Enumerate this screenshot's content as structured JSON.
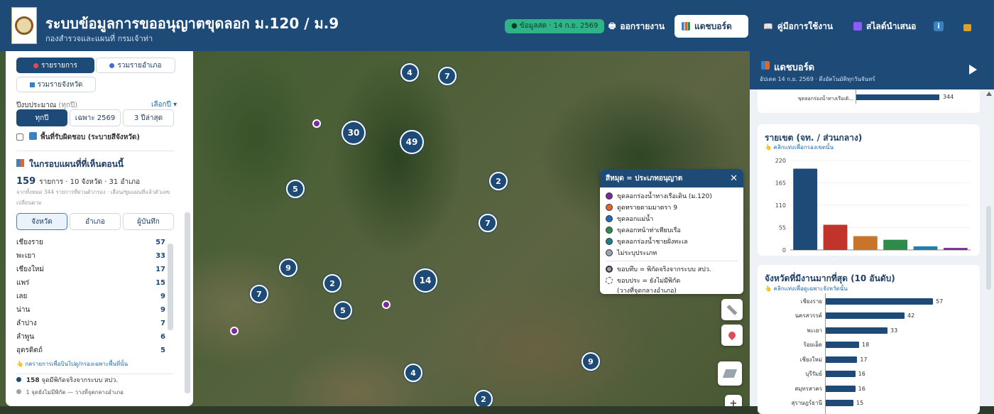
{
  "header": {
    "title": "ระบบข้อมูลการขออนุญาตขุดลอก ม.120 / ม.9",
    "subtitle": "กองสำรวจและแผนที่ กรมเจ้าท่า",
    "data_pill": "● ข้อมูลสด · 14 ก.ย. 2569",
    "nav": {
      "report": "ออกรายงาน",
      "dashboard": "แดชบอร์ด",
      "manual": "คู่มือการใช้งาน",
      "slides": "สไลด์นำเสนอ"
    }
  },
  "left": {
    "view_tabs": {
      "list": "รายรายการ",
      "district": "รวมรายอำเภอ",
      "province": "รวมรายจังหวัด"
    },
    "budget_label": "ปีงบประมาณ",
    "budget_hint": "(ทุกปี)",
    "budget_select": "เลือกปี ▾",
    "year_tabs": {
      "all": "ทุกปี",
      "only": "เฉพาะ 2569",
      "last3": "3 ปีล่าสุด"
    },
    "area_checkbox": "พื้นที่รับผิดชอบ (ระบายสีจังหวัด)",
    "inframe_title": "ในกรอบแผนที่ที่เห็นตอนนี้",
    "inframe_count": "159",
    "inframe_summary": "รายการ · 10 จังหวัด · 31 อำเภอ",
    "inframe_note": "จากทั้งหมด 344 รายการที่ผ่านตัวกรอง · เลื่อน/ซูมแผนที่แล้วตัวเลขเปลี่ยนตาม",
    "group_tabs": {
      "province": "จังหวัด",
      "district": "อำเภอ",
      "recorder": "ผู้บันทึก"
    },
    "provinces": [
      {
        "name": "เชียงราย",
        "count": "57"
      },
      {
        "name": "พะเยา",
        "count": "33"
      },
      {
        "name": "เชียงใหม่",
        "count": "17"
      },
      {
        "name": "แพร่",
        "count": "15"
      },
      {
        "name": "เลย",
        "count": "9"
      },
      {
        "name": "น่าน",
        "count": "9"
      },
      {
        "name": "ลำปาง",
        "count": "7"
      },
      {
        "name": "ลำพูน",
        "count": "6"
      },
      {
        "name": "อุตรดิตถ์",
        "count": "5"
      }
    ],
    "hint_click": "กดรายการเพื่อบินไปดู/กรองเฉพาะพื้นที่นั้น",
    "pinned_count": "158",
    "pinned_text": "จุดมีพิกัดจริงจากระบบ สปว.",
    "unpinned_text": "1 จุดยังไม่มีพิกัด — วางที่จุดกลางอำเภอ"
  },
  "map": {
    "clusters": [
      "4",
      "7",
      "30",
      "49",
      "5",
      "2",
      "7",
      "9",
      "2",
      "14",
      "7",
      "5",
      "4",
      "9",
      "2"
    ]
  },
  "legend": {
    "title": "สีหมุด = ประเภทอนุญาต",
    "items": [
      {
        "label": "ขุดลอกร่องน้ำทางเรือเดิน (ม.120)",
        "color": "#7b2a9e"
      },
      {
        "label": "ดูดทรายตามมาตรา 9",
        "color": "#e0672a"
      },
      {
        "label": "ขุดลอกแม่น้ำ",
        "color": "#1f6fb2"
      },
      {
        "label": "ขุดลอกหน้าท่าเทียบเรือ",
        "color": "#2e8b4a"
      },
      {
        "label": "ขุดลอกร่องน้ำชายฝั่งทะเล",
        "color": "#1c7f8a"
      },
      {
        "label": "ไม่ระบุประเภท",
        "color": "#9aa4b0"
      }
    ],
    "border_solid": "ขอบทึบ = พิกัดจริงจากระบบ สปว.",
    "border_dashed": "ขอบประ = ยังไม่มีพิกัด",
    "border_dashed_2": "(วางที่จุดกลางอำเภอ)"
  },
  "right": {
    "title": "แดชบอร์ด",
    "updated": "อัปเดต 14 ก.ย. 2569 · ดึงอัตโนมัติทุกวันจันทร์",
    "top_partial": {
      "label": "ขุดลอกร่องน้ำทางเรือเดิ...",
      "value": "344"
    },
    "region_card": {
      "title": "รายเขต (จท. / ส่วนกลาง)",
      "sub": "คลิกแท่งเพื่อกรองเขตนั้น"
    },
    "province_card": {
      "title": "จังหวัดที่มีงานมากที่สุด (10 อันดับ)",
      "sub": "คลิกแท่งเพื่อดูเฉพาะจังหวัดนั้น"
    }
  },
  "chart_data": [
    {
      "type": "bar",
      "title": "รายเขต (จท. / ส่วนกลาง)",
      "categories": [
        "จท.1",
        "จท.7",
        "จท.4",
        "จท.3",
        "จท.2",
        "จท.5"
      ],
      "values": [
        200,
        62,
        34,
        25,
        9,
        5
      ],
      "colors": [
        "#1e4a78",
        "#c0342b",
        "#c8742a",
        "#2e8b4a",
        "#1f7fb0",
        "#7b2a9e"
      ],
      "yticks": [
        "0",
        "55",
        "110",
        "165",
        "220"
      ],
      "ylim": [
        0,
        220
      ]
    },
    {
      "type": "bar",
      "orientation": "horizontal",
      "title": "จังหวัดที่มีงานมากที่สุด (10 อันดับ)",
      "categories": [
        "เชียงราย",
        "นครสวรรค์",
        "พะเยา",
        "ร้อยเอ็ด",
        "เชียงใหม่",
        "บุรีรัมย์",
        "สมุทรสาคร",
        "สุราษฎร์ธานี"
      ],
      "values": [
        57,
        42,
        33,
        18,
        17,
        16,
        16,
        15
      ],
      "max": 57
    }
  ],
  "colors": {
    "primary": "#1e4a78",
    "accent_green": "#2fb487"
  }
}
